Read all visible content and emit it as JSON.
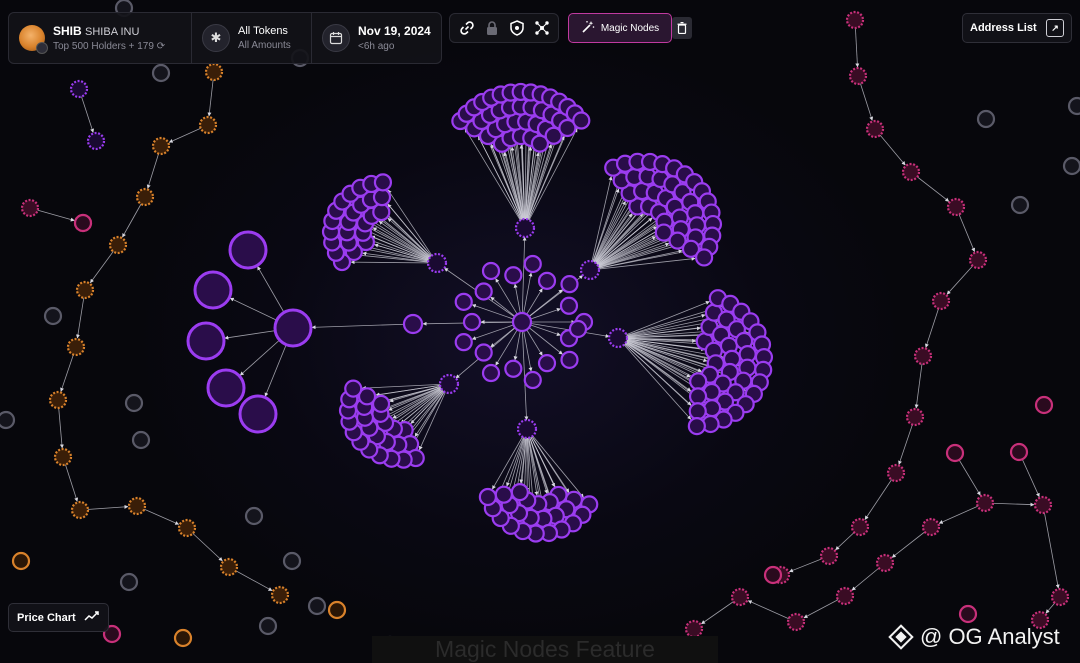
{
  "token": {
    "symbol": "SHIB",
    "name": "SHIBA INU",
    "holders_text": "Top 500 Holders + 179"
  },
  "filter": {
    "title": "All Tokens",
    "subtitle": "All Amounts"
  },
  "date": {
    "title": "Nov 19, 2024",
    "subtitle": "<6h ago"
  },
  "toolbar": {
    "icons": [
      "link-icon",
      "lock-icon",
      "shield-icon",
      "cluster-icon"
    ],
    "magic_label": "Magic Nodes",
    "trash_icon": "trash-icon"
  },
  "address_list": {
    "label": "Address List",
    "icon": "expand-icon"
  },
  "price_chart": {
    "label": "Price Chart",
    "icon": "trend-line-icon"
  },
  "caption": "Magic Nodes Feature",
  "watermark": {
    "text": "@ OG Analyst",
    "icon": "binance-diamond-icon"
  },
  "colors": {
    "purple": "#9b3cf0",
    "purple_fill": "#2a0d4a",
    "magenta": "#c8307a",
    "orange": "#d9822b",
    "gray": "#5a5a68",
    "accent": "#c03aa0"
  }
}
